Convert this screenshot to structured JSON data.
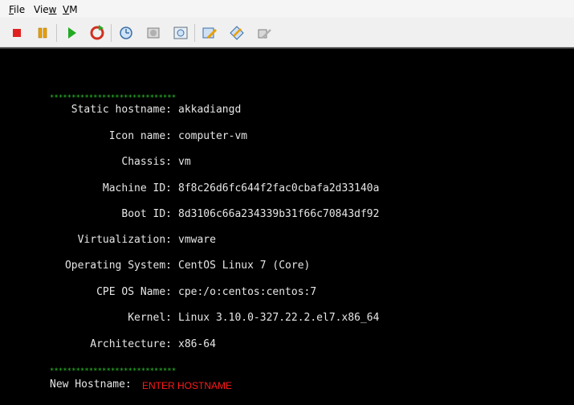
{
  "menu": {
    "file": "File",
    "file_key": "F",
    "file_rest": "ile",
    "view": "View",
    "view_pre": "Vie",
    "view_key": "w",
    "vm": "VM",
    "vm_key": "V",
    "vm_rest": "M"
  },
  "toolbar": {
    "icons": [
      "stop-icon",
      "pause-icon",
      "play-icon",
      "reset-icon",
      "snapshot-icon",
      "revert-snapshot-icon",
      "manage-snapshots-icon",
      "edit-settings-icon",
      "install-tools-icon",
      "send-keys-icon"
    ],
    "colors": {
      "stop": "#e02020",
      "pause": "#e8a000",
      "play": "#22aa22",
      "reset": "#d03020"
    }
  },
  "console": {
    "stars_top": "*****************************",
    "rows": [
      {
        "label": "Static hostname:",
        "value": "akkadiangd"
      },
      {
        "label": "Icon name:",
        "value": "computer-vm"
      },
      {
        "label": "Chassis:",
        "value": "vm"
      },
      {
        "label": "Machine ID:",
        "value": "8f8c26d6fc644f2fac0cbafa2d33140a"
      },
      {
        "label": "Boot ID:",
        "value": "8d3106c66a234339b31f66c70843df92"
      },
      {
        "label": "Virtualization:",
        "value": "vmware"
      },
      {
        "label": "Operating System:",
        "value": "CentOS Linux 7 (Core)"
      },
      {
        "label": "CPE OS Name:",
        "value": "cpe:/o:centos:centos:7"
      },
      {
        "label": "Kernel:",
        "value": "Linux 3.10.0-327.22.2.el7.x86_64"
      },
      {
        "label": "Architecture:",
        "value": "x86-64"
      }
    ],
    "stars_bottom": "*****************************",
    "prompt_label": "New Hostname:",
    "prompt_value": "ENTER HOSTNAME"
  }
}
